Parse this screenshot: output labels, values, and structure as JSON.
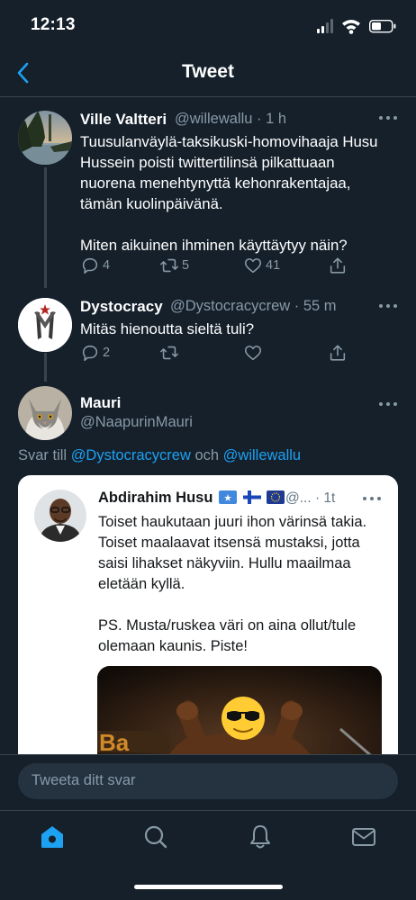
{
  "status_bar": {
    "time": "12:13"
  },
  "nav": {
    "title": "Tweet"
  },
  "tweets": [
    {
      "name": "Ville Valtteri",
      "handle": "@willewallu · 1 h",
      "text": "Tuusulanväylä-taksikuski-homovihaaja Husu Hussein poisti twittertilinsä pilkattuaan nuorena menehtynyttä kehonrakentajaa, tämän kuolinpäivänä.\n\nMiten aikuinen ihminen käyttäytyy näin?",
      "replies": "4",
      "retweets": "5",
      "likes": "41"
    },
    {
      "name": "Dystocracy",
      "handle": "@Dystocracycrew · 55 m",
      "text": "Mitäs hienoutta sieltä tuli?",
      "replies": "2"
    },
    {
      "name": "Mauri",
      "handle": "@NaapurinMauri"
    }
  ],
  "reply_to": {
    "prefix": "Svar till ",
    "user1": "@Dystocracycrew",
    "joiner": " och ",
    "user2": "@willewallu"
  },
  "embedded": {
    "name": "Abdirahim Husu",
    "handle": "@... · 1t",
    "text": "Toiset haukutaan juuri ihon värinsä takia. Toiset maalaavat itsensä mustaksi, jotta saisi lihakset näkyviin. Hullu maailmaa eletään kyllä.\n\nPS. Musta/ruskea väri on aina ollut/tule olemaan kaunis. Piste!",
    "image_text": "Ba"
  },
  "composer": {
    "placeholder": "Tweeta ditt svar"
  },
  "colors": {
    "background": "#15202b",
    "accent": "#1da1f2",
    "muted": "#8899a6",
    "divider": "#38444d"
  }
}
